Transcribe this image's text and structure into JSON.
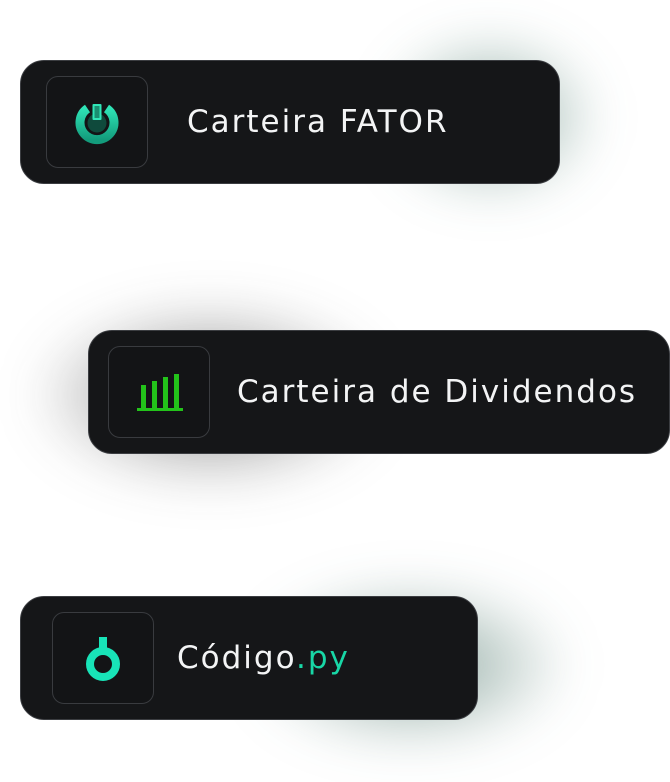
{
  "cards": [
    {
      "id": "fator",
      "label": "Carteira FATOR",
      "icon": "power-ring-icon",
      "icon_color": "#1fc9a0"
    },
    {
      "id": "dividendos",
      "label": "Carteira de Dividendos",
      "icon": "bar-chart-icon",
      "icon_color": "#23c31a"
    },
    {
      "id": "codigo",
      "label_main": "Código",
      "label_ext": ".py",
      "icon": "power-symbol-icon",
      "icon_color": "#18e4b8"
    }
  ],
  "colors": {
    "card_bg": "#151618",
    "card_border": "#3b3d41",
    "text": "#f3f4f5",
    "accent": "#18d7a6"
  }
}
